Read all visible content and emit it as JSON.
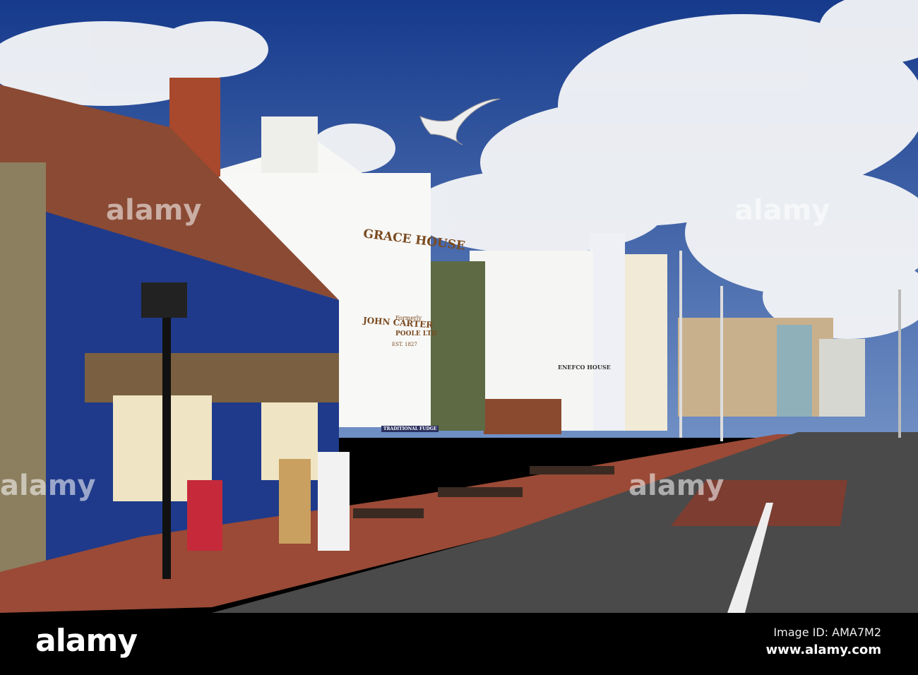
{
  "photo": {
    "description_free": true,
    "signs": {
      "building_name": "GRACE HOUSE",
      "formerly": "Formerly",
      "company": "JOHN CARTER",
      "company_suffix": "POOLE LTD",
      "established": "EST. 1827",
      "second_building": "ENEFCO HOUSE",
      "shop_awning": "TRADITIONAL FUDGE"
    },
    "watermark": "alamy"
  },
  "footer": {
    "logo": "alamy",
    "image_id": "Image ID: AMA7M2",
    "url": "www.alamy.com"
  },
  "colors": {
    "sky": "#1d3f8f",
    "pub_blue": "#1f3a8a",
    "road": "#4a4a4a",
    "pavement": "#9a4a36"
  }
}
